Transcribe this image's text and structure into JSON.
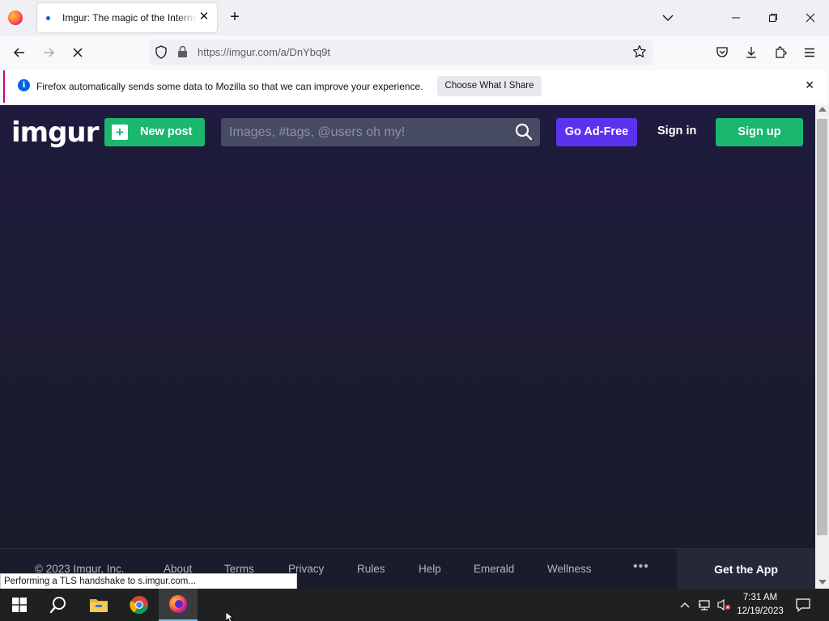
{
  "browser": {
    "tab": {
      "title": "Imgur: The magic of the Internet",
      "close_glyph": "✕"
    },
    "new_tab_glyph": "+",
    "url": "https://imgur.com/a/DnYbq9t",
    "notification": {
      "text": "Firefox automatically sends some data to Mozilla so that we can improve your experience.",
      "button": "Choose What I Share",
      "close_glyph": "✕",
      "info_glyph": "i"
    },
    "status": "Performing a TLS handshake to s.imgur.com..."
  },
  "imgur": {
    "logo": "imgur",
    "new_post": "New post",
    "search_placeholder": "Images, #tags, @users oh my!",
    "go_ad_free": "Go Ad-Free",
    "sign_in": "Sign in",
    "sign_up": "Sign up",
    "footer": {
      "copyright": "© 2023 Imgur, Inc.",
      "links": [
        "About",
        "Terms",
        "Privacy",
        "Rules",
        "Help",
        "Emerald",
        "Wellness"
      ],
      "more": "•••",
      "get_app": "Get the App"
    }
  },
  "taskbar": {
    "time": "7:31 AM",
    "date": "12/19/2023"
  },
  "colors": {
    "imgur_green": "#1bb76e",
    "imgur_purple": "#5b33ef",
    "imgur_bg": "#1b1c2e",
    "firefox_blue": "#0061e0"
  }
}
